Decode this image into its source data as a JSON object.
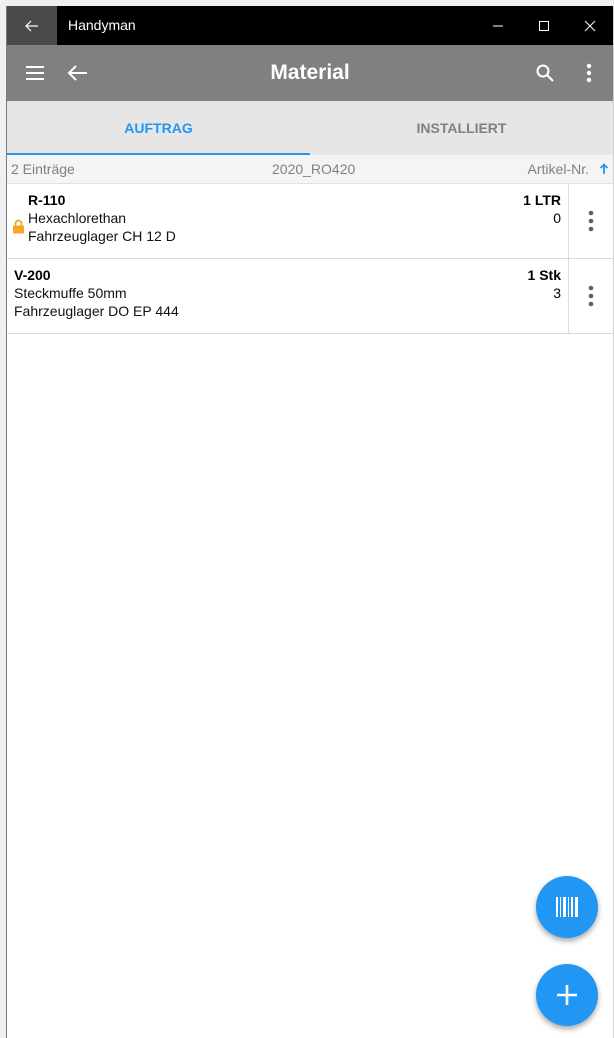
{
  "window": {
    "title": "Handyman",
    "minimize": "—",
    "maximize": "☐",
    "close": "✕"
  },
  "appbar": {
    "title": "Material"
  },
  "tabs": [
    {
      "label": "AUFTRAG",
      "active": true
    },
    {
      "label": "INSTALLIERT",
      "active": false
    }
  ],
  "list_header": {
    "count": "2 Einträge",
    "order": "2020_RO420",
    "sort_label": "Artikel-Nr."
  },
  "items": [
    {
      "code": "R-110",
      "name": "Hexachlorethan",
      "location": "Fahrzeuglager CH 12 D",
      "quantity": "1 LTR",
      "stock": "0",
      "locked": true
    },
    {
      "code": "V-200",
      "name": "Steckmuffe 50mm",
      "location": "Fahrzeuglager DO EP 444",
      "quantity": "1 Stk",
      "stock": "3",
      "locked": false
    }
  ],
  "colors": {
    "accent": "#2196f3",
    "appbar": "#808080",
    "titlebar": "#000000",
    "lock": "#f5a623"
  },
  "icons": {
    "scan_fab": "barcode-icon",
    "add_fab": "plus-icon"
  }
}
